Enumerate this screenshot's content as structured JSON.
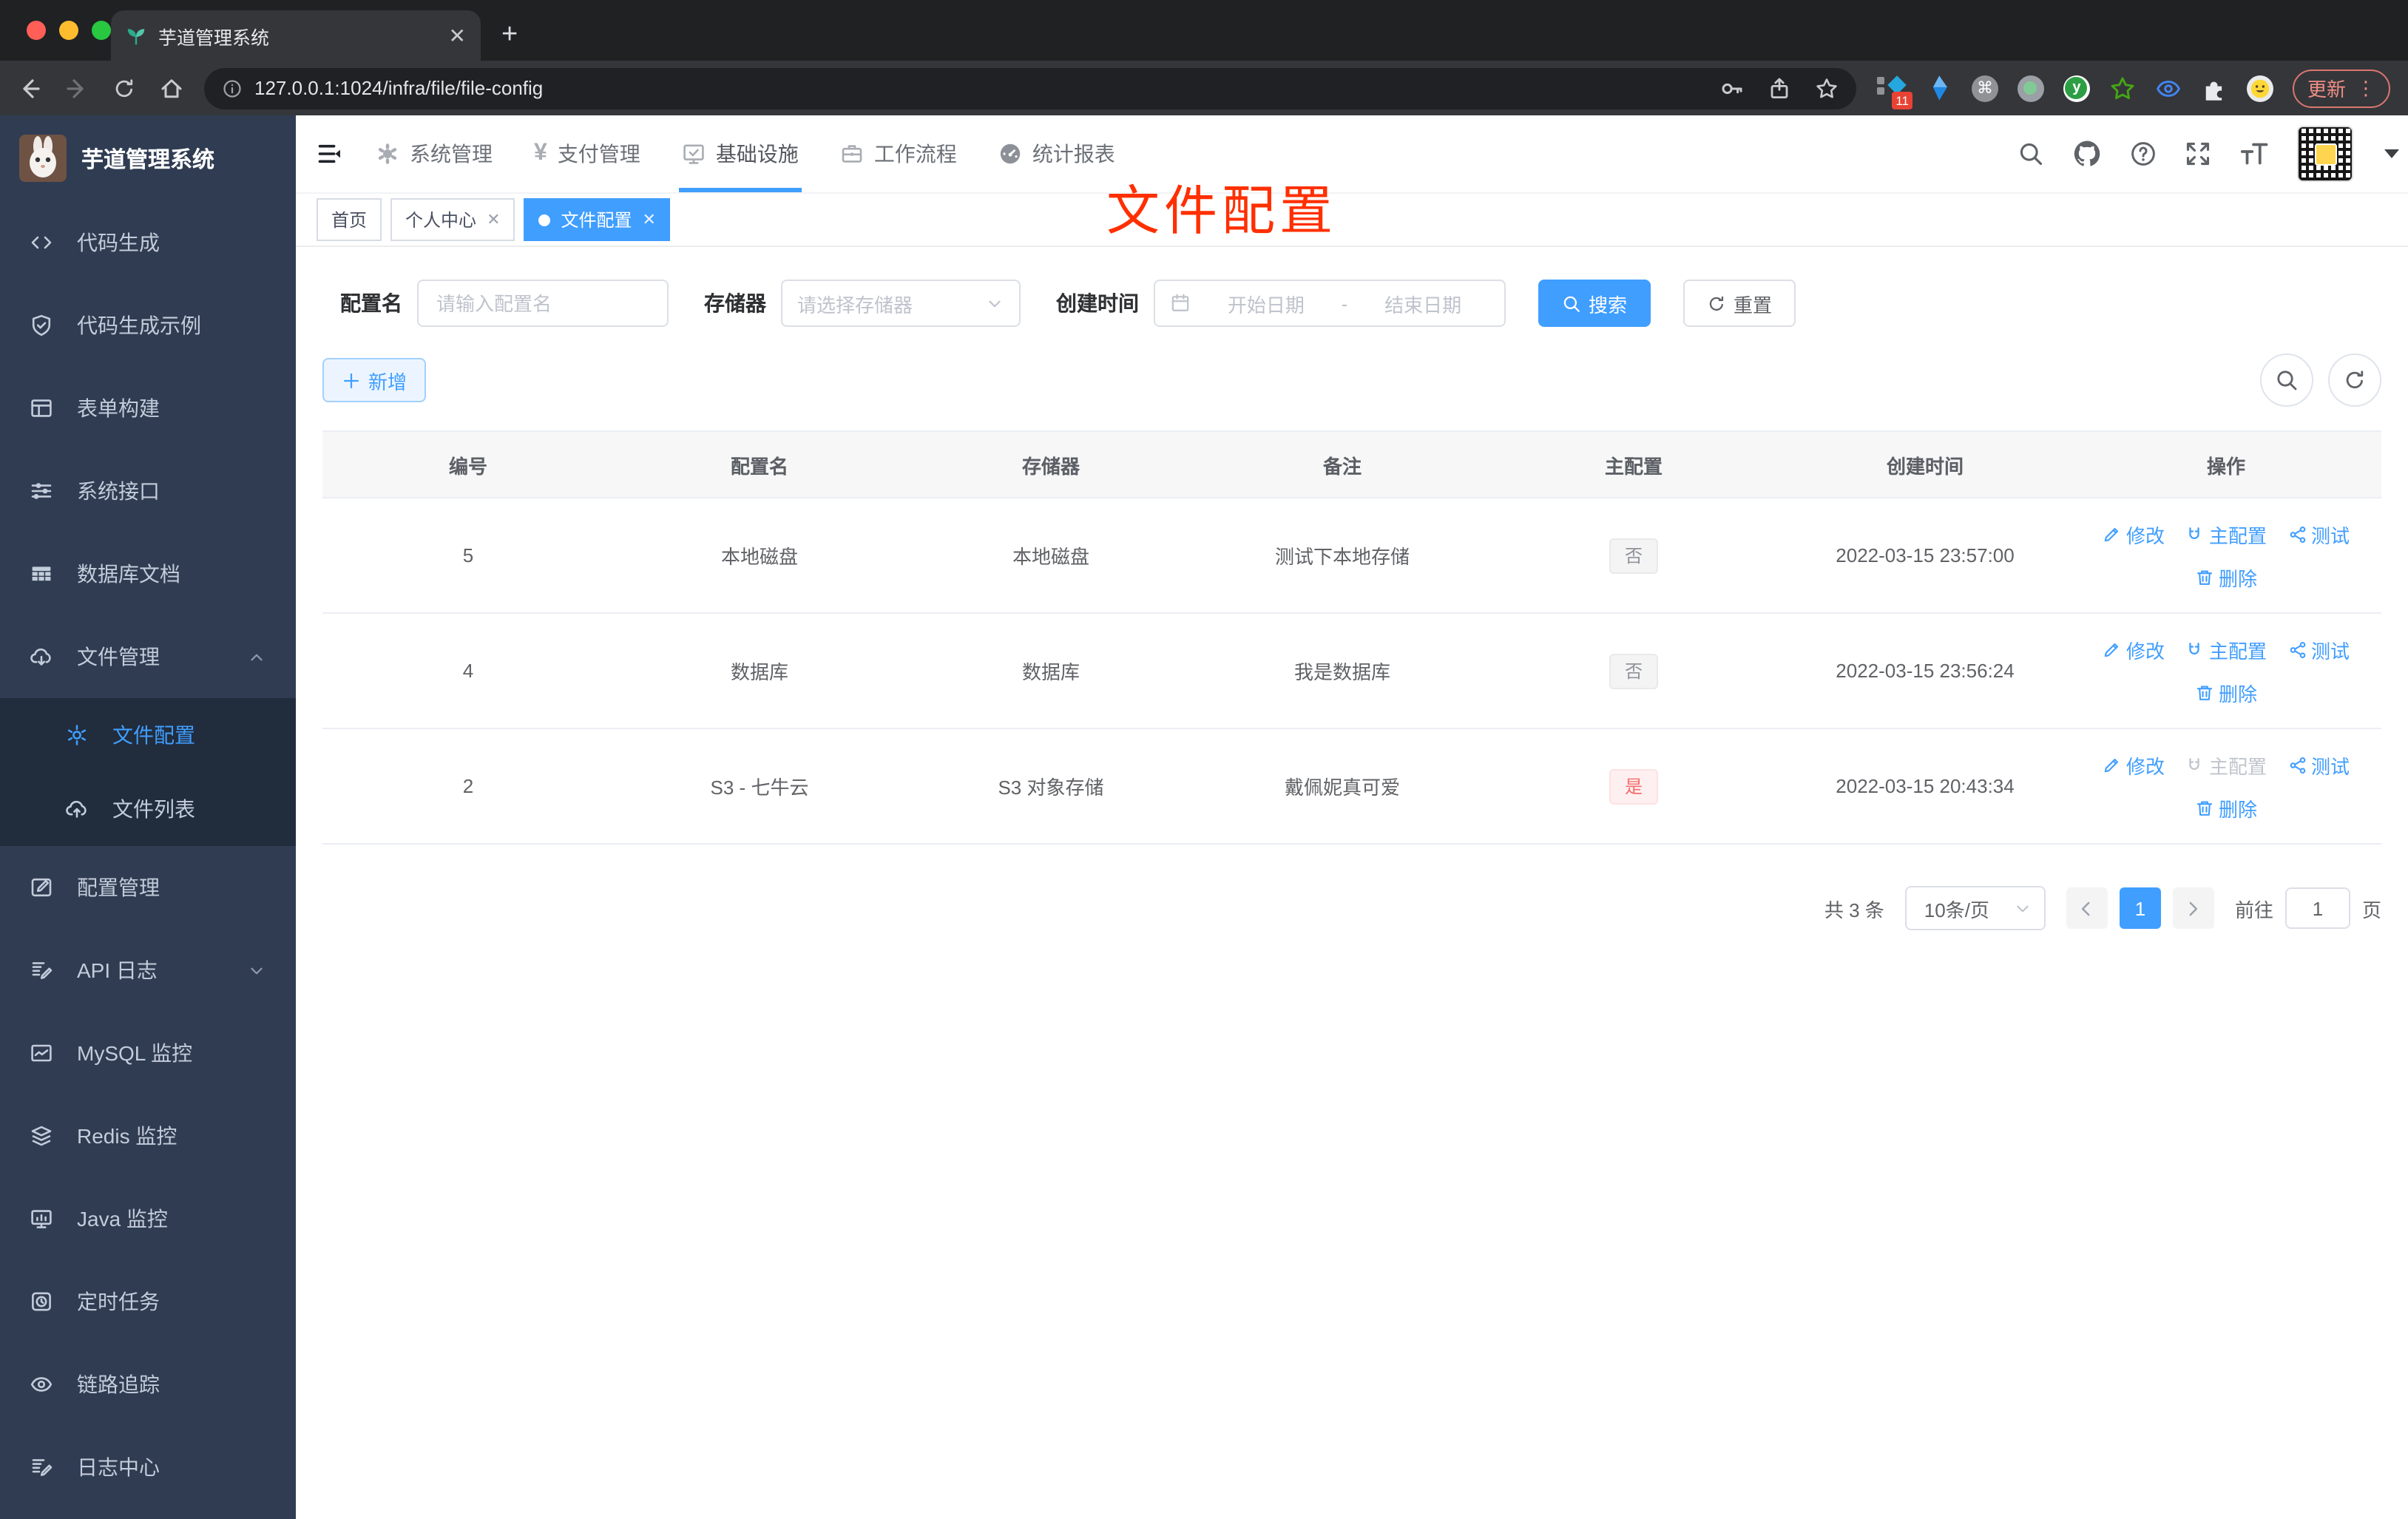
{
  "browser": {
    "tab_title": "芋道管理系统",
    "url": "127.0.0.1:1024/infra/file/file-config",
    "update_label": "更新",
    "extension_badge": "11"
  },
  "sidebar": {
    "app_title": "芋道管理系统",
    "items": [
      {
        "label": "代码生成",
        "icon": "code-icon"
      },
      {
        "label": "代码生成示例",
        "icon": "shield-check-icon"
      },
      {
        "label": "表单构建",
        "icon": "form-grid-icon"
      },
      {
        "label": "系统接口",
        "icon": "sliders-icon"
      },
      {
        "label": "数据库文档",
        "icon": "table-icon"
      },
      {
        "label": "文件管理",
        "icon": "cloud-download-icon",
        "expanded": true,
        "children": [
          {
            "label": "文件配置",
            "icon": "gear-icon",
            "active": true
          },
          {
            "label": "文件列表",
            "icon": "cloud-upload-icon"
          }
        ]
      },
      {
        "label": "配置管理",
        "icon": "edit-square-icon"
      },
      {
        "label": "API 日志",
        "icon": "doc-edit-icon",
        "collapsed": true
      },
      {
        "label": "MySQL 监控",
        "icon": "chart-icon"
      },
      {
        "label": "Redis 监控",
        "icon": "layers-icon"
      },
      {
        "label": "Java 监控",
        "icon": "monitor-icon"
      },
      {
        "label": "定时任务",
        "icon": "timer-icon"
      },
      {
        "label": "链路追踪",
        "icon": "eye-icon"
      },
      {
        "label": "日志中心",
        "icon": "doc-edit-icon"
      }
    ]
  },
  "topnav": {
    "items": [
      {
        "label": "系统管理",
        "icon": "gear-filled-icon"
      },
      {
        "label": "支付管理",
        "icon": "yen-icon"
      },
      {
        "label": "基础设施",
        "icon": "monitor-check-icon",
        "active": true
      },
      {
        "label": "工作流程",
        "icon": "briefcase-icon"
      },
      {
        "label": "统计报表",
        "icon": "gauge-icon"
      }
    ]
  },
  "tabs": [
    {
      "label": "首页"
    },
    {
      "label": "个人中心",
      "closable": true
    },
    {
      "label": "文件配置",
      "closable": true,
      "active": true
    }
  ],
  "annotation": {
    "text": "文件配置",
    "color": "#ff2f00"
  },
  "filters": {
    "name_label": "配置名",
    "name_placeholder": "请输入配置名",
    "storage_label": "存储器",
    "storage_placeholder": "请选择存储器",
    "time_label": "创建时间",
    "start_placeholder": "开始日期",
    "range_separator": "-",
    "end_placeholder": "结束日期",
    "search_label": "搜索",
    "reset_label": "重置"
  },
  "toolbar": {
    "add_label": "新增"
  },
  "table": {
    "columns": [
      "编号",
      "配置名",
      "存储器",
      "备注",
      "主配置",
      "创建时间",
      "操作"
    ],
    "actions": {
      "edit": "修改",
      "master": "主配置",
      "test": "测试",
      "delete": "删除"
    },
    "rows": [
      {
        "id": "5",
        "name": "本地磁盘",
        "storage": "本地磁盘",
        "remark": "测试下本地存储",
        "master": "否",
        "master_type": "info",
        "created": "2022-03-15 23:57:00",
        "master_disabled": false
      },
      {
        "id": "4",
        "name": "数据库",
        "storage": "数据库",
        "remark": "我是数据库",
        "master": "否",
        "master_type": "info",
        "created": "2022-03-15 23:56:24",
        "master_disabled": false
      },
      {
        "id": "2",
        "name": "S3 - 七牛云",
        "storage": "S3 对象存储",
        "remark": "戴佩妮真可爱",
        "master": "是",
        "master_type": "danger",
        "created": "2022-03-15 20:43:34",
        "master_disabled": true
      }
    ]
  },
  "pagination": {
    "total": "共 3 条",
    "page_size": "10条/页",
    "current": "1",
    "goto_label": "前往",
    "goto_value": "1",
    "page_unit": "页"
  },
  "colors": {
    "accent": "#409eff",
    "danger": "#f56c6c",
    "sidebar_bg": "#2f3c52",
    "annotation": "#ff2f00"
  },
  "icons": {
    "search-icon": "magnifier",
    "refresh-icon": "circular arrows",
    "gear-icon": "cog",
    "plus-icon": "+",
    "close-icon": "×",
    "calendar-icon": "calendar",
    "trash-icon": "trash can",
    "pencil-icon": "pencil",
    "magnet-icon": "magnet",
    "share-icon": "share nodes",
    "github-icon": "github cat",
    "help-icon": "? in circle",
    "fullscreen-icon": "expand arrows",
    "font-size-icon": "tT",
    "collapse-sidebar-icon": "lines with left triangle"
  }
}
